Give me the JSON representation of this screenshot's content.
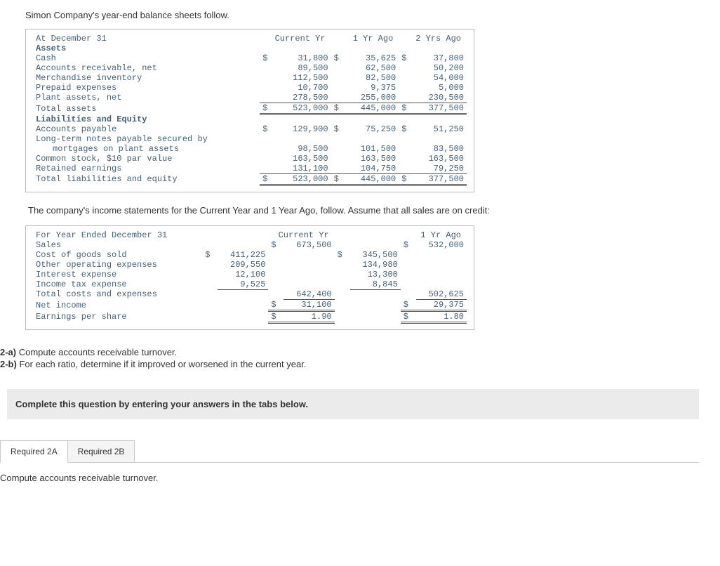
{
  "intro": "Simon Company's year-end balance sheets follow.",
  "bs": {
    "header_label": "At December 31",
    "col1": "Current Yr",
    "col2": "1 Yr Ago",
    "col3": "2 Yrs Ago",
    "assets_hdr": "Assets",
    "rows": {
      "cash": {
        "label": "Cash",
        "c1": "31,800",
        "c2": "35,625",
        "c3": "37,800"
      },
      "ar": {
        "label": "Accounts receivable, net",
        "c1": "89,500",
        "c2": "62,500",
        "c3": "50,200"
      },
      "inv": {
        "label": "Merchandise inventory",
        "c1": "112,500",
        "c2": "82,500",
        "c3": "54,000"
      },
      "prepaid": {
        "label": "Prepaid expenses",
        "c1": "10,700",
        "c2": "9,375",
        "c3": "5,000"
      },
      "plant": {
        "label": "Plant assets, net",
        "c1": "278,500",
        "c2": "255,000",
        "c3": "230,500"
      },
      "total_assets": {
        "label": "Total assets",
        "c1": "523,000",
        "c2": "445,000",
        "c3": "377,500"
      }
    },
    "liab_hdr": "Liabilities and Equity",
    "liab_rows": {
      "ap": {
        "label": "Accounts payable",
        "c1": "129,900",
        "c2": "75,250",
        "c3": "51,250"
      },
      "ltn1": {
        "label": "Long-term notes payable secured by"
      },
      "ltn2": {
        "label": "mortgages on plant assets",
        "c1": "98,500",
        "c2": "101,500",
        "c3": "83,500"
      },
      "common": {
        "label": "Common stock, $10 par value",
        "c1": "163,500",
        "c2": "163,500",
        "c3": "163,500"
      },
      "re": {
        "label": "Retained earnings",
        "c1": "131,100",
        "c2": "104,750",
        "c3": "79,250"
      },
      "total_le": {
        "label": "Total liabilities and equity",
        "c1": "523,000",
        "c2": "445,000",
        "c3": "377,500"
      }
    }
  },
  "is_intro": "The company's income statements for the Current Year and 1 Year Ago, follow. Assume that all sales are on credit:",
  "is": {
    "header_label": "For Year Ended December 31",
    "col1": "Current Yr",
    "col2": "1 Yr Ago",
    "rows": {
      "sales": {
        "label": "Sales",
        "c1t": "673,500",
        "c2t": "532,000"
      },
      "cogs": {
        "label": "Cost of goods sold",
        "c1s": "411,225",
        "c2s": "345,500"
      },
      "opex": {
        "label": "Other operating expenses",
        "c1s": "209,550",
        "c2s": "134,980"
      },
      "int": {
        "label": "Interest expense",
        "c1s": "12,100",
        "c2s": "13,300"
      },
      "tax": {
        "label": "Income tax expense",
        "c1s": "9,525",
        "c2s": "8,845"
      },
      "tcx": {
        "label": "Total costs and expenses",
        "c1t": "642,400",
        "c2t": "502,625"
      },
      "ni": {
        "label": "Net income",
        "c1t": "31,100",
        "c2t": "29,375"
      },
      "eps": {
        "label": "Earnings per share",
        "c1t": "1.90",
        "c2t": "1.80"
      }
    }
  },
  "q2a_label": "2-a)",
  "q2a_text": " Compute accounts receivable turnover.",
  "q2b_label": "2-b)",
  "q2b_text": " For each ratio, determine if it improved or worsened in the current year.",
  "complete_text": "Complete this question by entering your answers in the tabs below.",
  "tabs": {
    "a": "Required 2A",
    "b": "Required 2B"
  },
  "tab_content": "Compute accounts receivable turnover."
}
